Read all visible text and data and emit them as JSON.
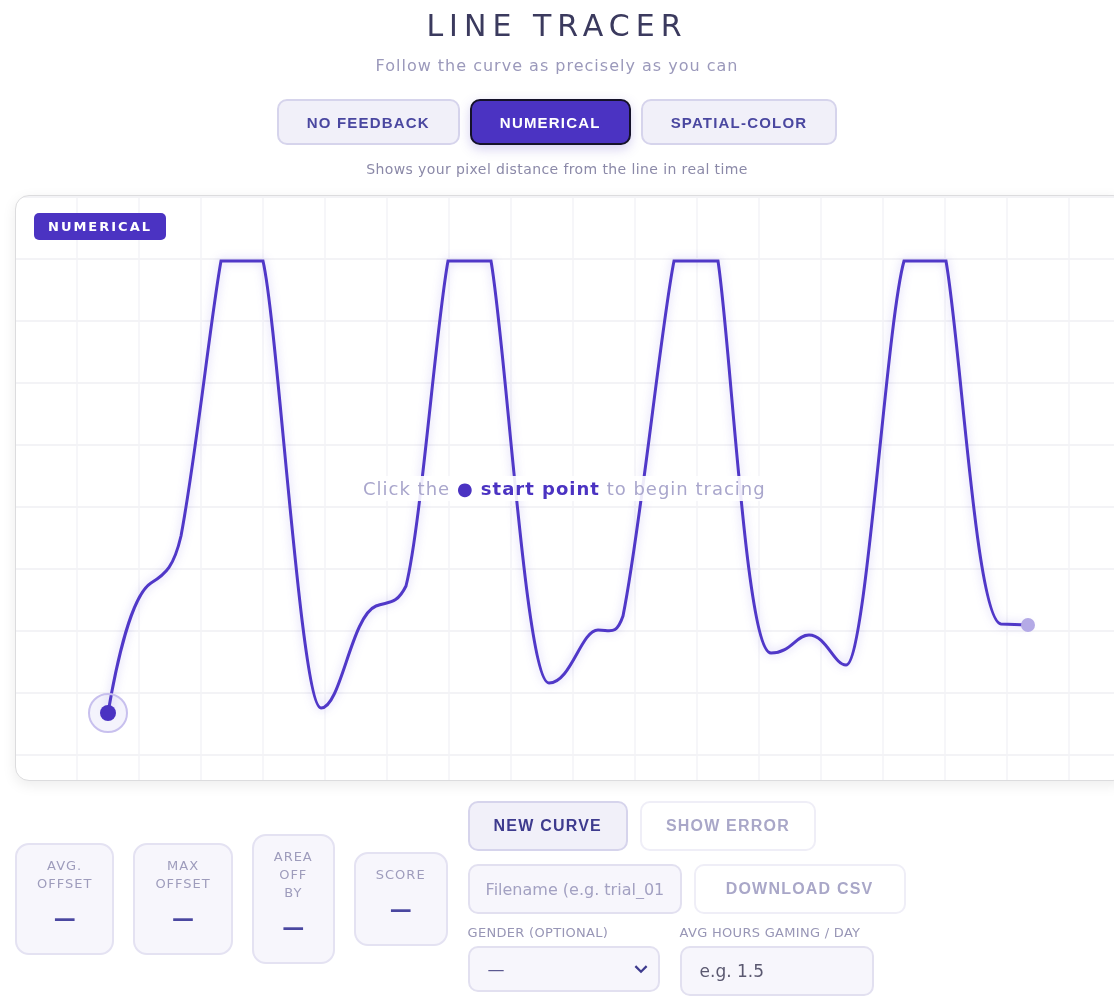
{
  "title": "LINE TRACER",
  "subtitle": "Follow the curve as precisely as you can",
  "modes": [
    {
      "label": "NO FEEDBACK",
      "selected": false
    },
    {
      "label": "NUMERICAL",
      "selected": true
    },
    {
      "label": "SPATIAL-COLOR",
      "selected": false
    }
  ],
  "mode_description": "Shows your pixel distance from the line in real time",
  "canvas": {
    "badge": "NUMERICAL",
    "hint": "Click the **● start point** to begin tracing"
  },
  "stats": [
    {
      "label": "AVG. OFFSET",
      "value": "—"
    },
    {
      "label": "MAX OFFSET",
      "value": "—"
    },
    {
      "label": "AREA OFF BY",
      "value": "—"
    },
    {
      "label": "SCORE",
      "value": "—"
    }
  ],
  "actions": [
    {
      "label": "NEW CURVE",
      "disabled": false
    },
    {
      "label": "SHOW ERROR",
      "disabled": true
    }
  ],
  "filename": {
    "placeholder": "Filename (e.g. trial_01"
  },
  "download": {
    "label": "DOWNLOAD CSV",
    "disabled": true
  },
  "gender": {
    "label": "GENDER (OPTIONAL)",
    "value": "—"
  },
  "gaming": {
    "label": "AVG HOURS GAMING / DAY",
    "placeholder": "e.g. 1.5"
  }
}
